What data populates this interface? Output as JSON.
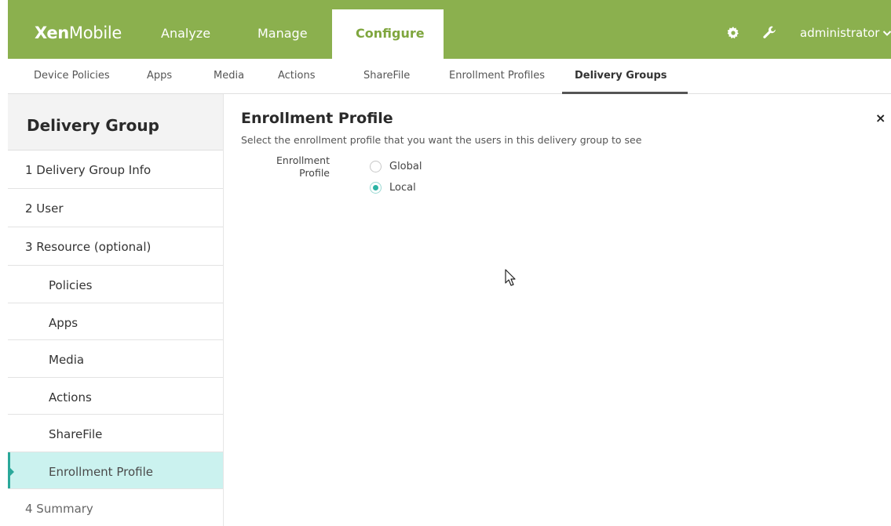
{
  "app": {
    "logo_bold": "Xen",
    "logo_light": "Mobile",
    "brand_color": "#8bb04e"
  },
  "topnav": {
    "items": [
      "Analyze",
      "Manage"
    ],
    "active": "Configure",
    "user": "administrator"
  },
  "subnav": {
    "items": [
      "Device Policies",
      "Apps",
      "Media",
      "Actions",
      "ShareFile",
      "Enrollment Profiles"
    ],
    "active": "Delivery Groups"
  },
  "sidebar": {
    "title": "Delivery Group",
    "steps": [
      {
        "label": "1  Delivery Group Info"
      },
      {
        "label": "2  User"
      },
      {
        "label": "3  Resource (optional)"
      }
    ],
    "sub_items": [
      {
        "label": "Policies"
      },
      {
        "label": "Apps"
      },
      {
        "label": "Media"
      },
      {
        "label": "Actions"
      },
      {
        "label": "ShareFile"
      },
      {
        "label": "Enrollment Profile"
      }
    ],
    "summary": "4  Summary",
    "active_color": "#cbf2ef"
  },
  "main": {
    "title": "Enrollment Profile",
    "description": "Select the enrollment profile that you want the users in this delivery group to see",
    "field_label_line1": "Enrollment",
    "field_label_line2": "Profile",
    "options": [
      {
        "label": "Global",
        "selected": false
      },
      {
        "label": "Local",
        "selected": true
      }
    ],
    "close_glyph": "×"
  }
}
